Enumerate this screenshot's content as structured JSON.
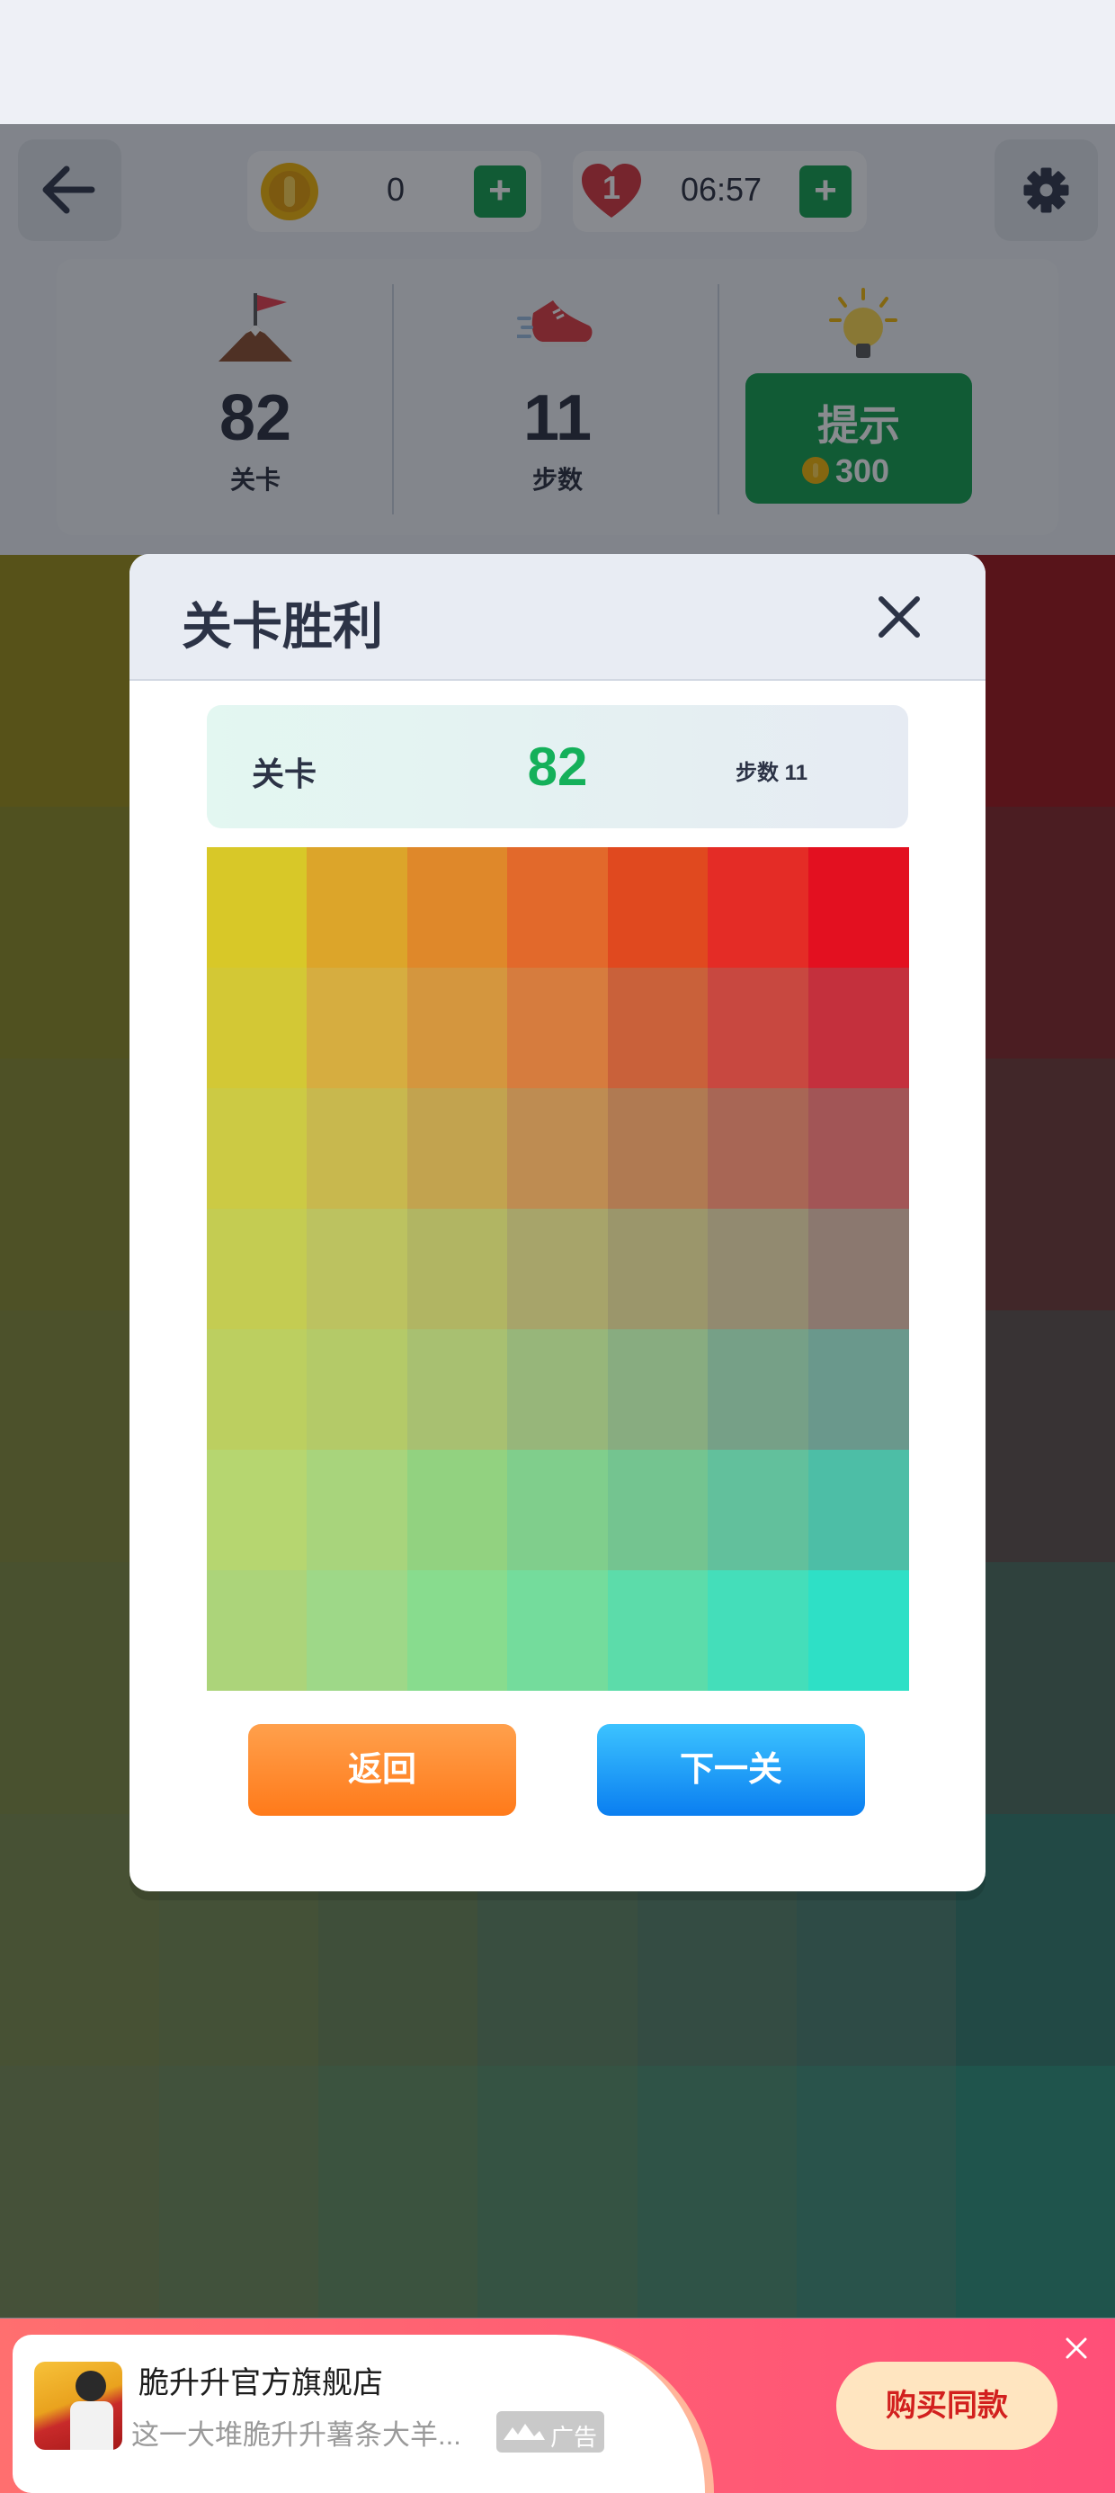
{
  "header": {
    "coins": "0",
    "lives": "1",
    "timer": "06:57",
    "plus_label": "+"
  },
  "stats": {
    "level_value": "82",
    "level_label": "关卡",
    "steps_value": "11",
    "steps_label": "步数",
    "hint_label": "提示",
    "hint_cost": "300"
  },
  "modal": {
    "title": "关卡胜利",
    "level_label": "关卡",
    "level_value": "82",
    "steps_text": "步数 11",
    "grid_colors": [
      [
        "#d8c828",
        "#dca52a",
        "#df882a",
        "#e2692b",
        "#e0491f",
        "#e42c26",
        "#e31020"
      ],
      [
        "#d3c835",
        "#d6ad40",
        "#d4963e",
        "#d67c3e",
        "#c9613a",
        "#c84840",
        "#c4303d"
      ],
      [
        "#ccca44",
        "#c8b84e",
        "#c2a34f",
        "#be8c52",
        "#b07a52",
        "#a86655",
        "#a25556"
      ],
      [
        "#c4cc52",
        "#bcc260",
        "#b1b563",
        "#a7a46a",
        "#9b966b",
        "#928a70",
        "#8b786f"
      ],
      [
        "#bccf60",
        "#b4ca68",
        "#a8c071",
        "#97b67a",
        "#88ac80",
        "#76a087",
        "#6a988c"
      ],
      [
        "#b6d670",
        "#a8d47c",
        "#92d280",
        "#80ce8c",
        "#74c490",
        "#62c09c",
        "#4dbea6"
      ],
      [
        "#acd47a",
        "#9ed888",
        "#88dc8e",
        "#74dc9c",
        "#5cdcaa",
        "#44deba",
        "#2ee0c6"
      ]
    ],
    "back_label": "返回",
    "next_label": "下一关"
  },
  "board_colors": [
    [
      "#9a8c12",
      "#8e8c14",
      "#8e7e1a",
      "#8c6a18",
      "#8c5218",
      "#8c3618",
      "#9c1014"
    ],
    [
      "#8c8a20",
      "#888624",
      "#887a2a",
      "#826e28",
      "#7e5826",
      "#7e4226",
      "#822224"
    ],
    [
      "#888a2c",
      "#848430",
      "#7e7a34",
      "#787036",
      "#706236",
      "#6c5234",
      "#6e3632"
    ],
    [
      "#848a36",
      "#7e843c",
      "#787e40",
      "#707444",
      "#686a46",
      "#5e5e48",
      "#5c4e48"
    ],
    [
      "#7e8a3e",
      "#788444",
      "#70804c",
      "#687a52",
      "#5e7454",
      "#546c58",
      "#4a6a5a"
    ],
    [
      "#7a8a48",
      "#748a4e",
      "#6a8654",
      "#5e8460",
      "#548066",
      "#487e6c",
      "#307a6a"
    ],
    [
      "#768a52",
      "#6e8c58",
      "#628e5e",
      "#568e66",
      "#4a8e6e",
      "#3e8e76",
      "#2a9078"
    ]
  ],
  "board_top_colors": [
    [
      "#7c8c48",
      "#6e8c4c",
      "#5e8e52",
      "#4e8e5a",
      "#3e8e62",
      "#2e8e6a",
      "#2a8c6e"
    ],
    [
      "#7a8a50",
      "#6a9058",
      "#5a9460",
      "#4a9668",
      "#3a9870",
      "#2a9a78",
      "#1e9a7c"
    ]
  ],
  "ad": {
    "store_name": "脆升升官方旗舰店",
    "description": "这一大堆脆升升薯条大羊...",
    "ad_tag": "广告",
    "buy_label": "购买同款"
  }
}
